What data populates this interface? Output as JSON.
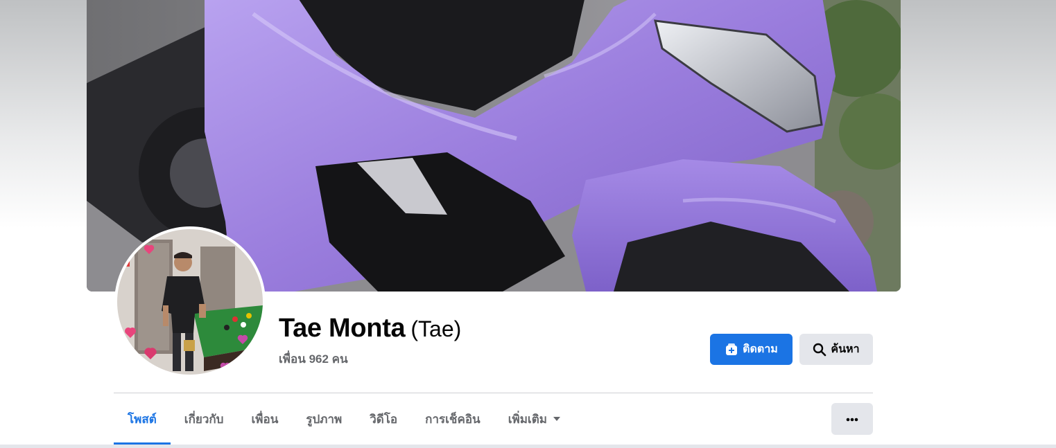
{
  "profile": {
    "name": "Tae Monta",
    "alternate_name": "(Tae)",
    "friends": "เพื่อน 962 คน"
  },
  "actions": {
    "follow_label": "ติดตาม",
    "search_label": "ค้นหา"
  },
  "tabs": [
    {
      "label": "โพสต์",
      "active": true
    },
    {
      "label": "เกี่ยวกับ",
      "active": false
    },
    {
      "label": "เพื่อน",
      "active": false
    },
    {
      "label": "รูปภาพ",
      "active": false
    },
    {
      "label": "วิดีโอ",
      "active": false
    },
    {
      "label": "การเช็คอิน",
      "active": false
    },
    {
      "label": "เพิ่มเติม",
      "active": false
    }
  ],
  "icons": {
    "follow": "follow-icon",
    "search": "search-icon",
    "more_caret": "caret-down-icon",
    "overflow": "more-options-icon"
  },
  "colors": {
    "accent": "#1b74e4",
    "button_secondary": "#e4e6eb",
    "text_primary": "#050505",
    "text_secondary": "#65676b",
    "cover_scooter": "#9b7fd9"
  }
}
